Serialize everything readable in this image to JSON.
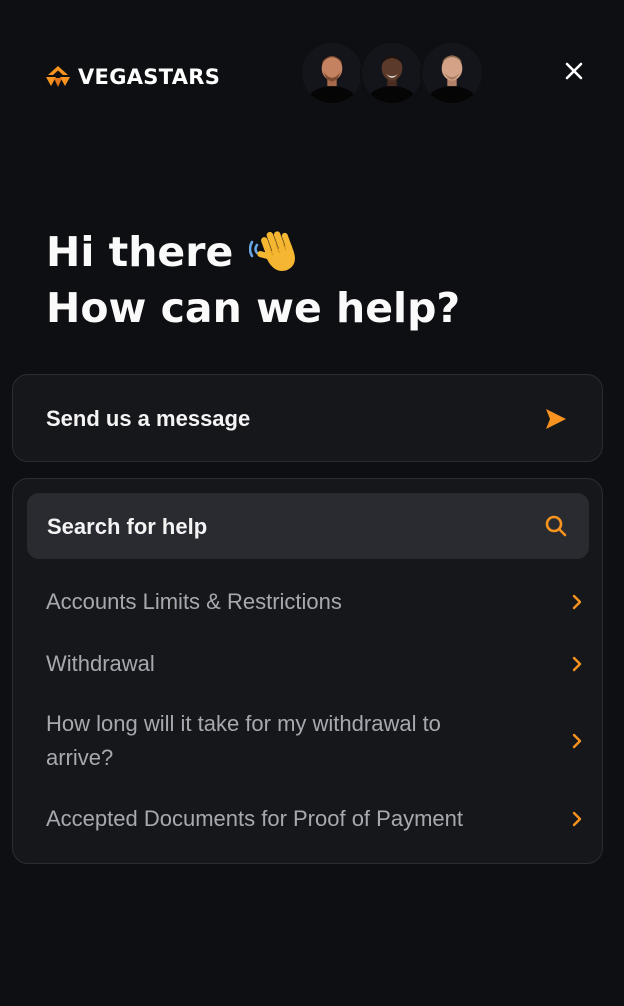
{
  "brand": {
    "name": "VEGASTARS",
    "accent_color": "#f7931e"
  },
  "header": {
    "avatars": [
      {
        "icon": "agent-avatar-1"
      },
      {
        "icon": "agent-avatar-2"
      },
      {
        "icon": "agent-avatar-3"
      }
    ],
    "close_icon": "close-icon"
  },
  "greeting": {
    "line1": "Hi there",
    "line1_icon": "waving-hand-icon",
    "line2": "How can we help?"
  },
  "send_message": {
    "label": "Send us a message",
    "icon": "send-arrow-icon"
  },
  "help": {
    "search_label": "Search for help",
    "search_icon": "search-icon",
    "items": [
      {
        "label": "Accounts Limits & Restrictions"
      },
      {
        "label": "Withdrawal"
      },
      {
        "label": "How long will it take for my withdrawal to arrive?"
      },
      {
        "label": "Accepted Documents for Proof of Payment"
      }
    ]
  }
}
